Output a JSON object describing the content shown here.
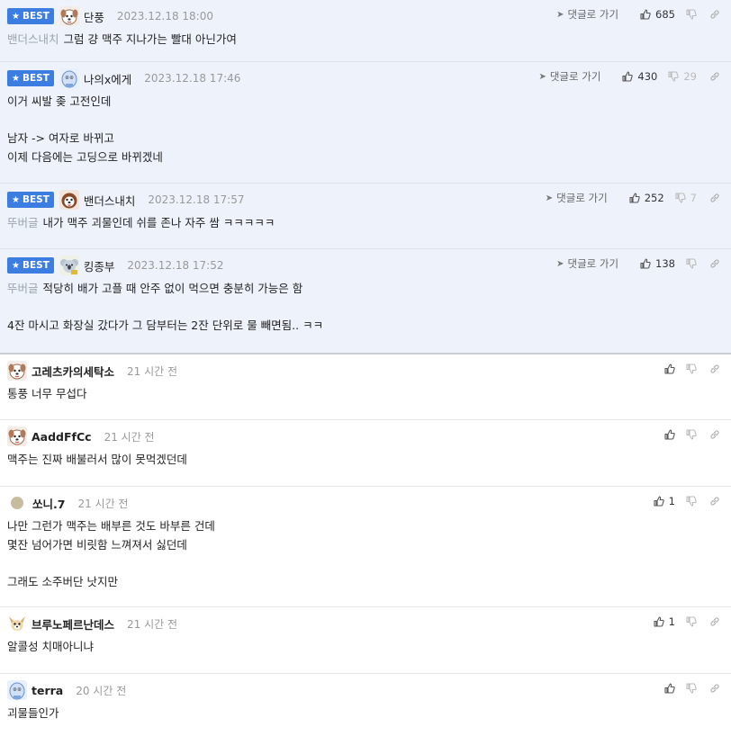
{
  "best_label": "BEST",
  "goto_label": "댓글로 가기",
  "comments": [
    {
      "best": true,
      "nick": "단풍",
      "time": "2023.12.18 18:00",
      "mention": "밴더스내치",
      "lines": [
        "그럼 걍 맥주 지나가는 빨대 아닌가여"
      ],
      "up": "685",
      "down": "",
      "avatar": "dog-white-avatar"
    },
    {
      "best": true,
      "nick": "나의x에게",
      "time": "2023.12.18 17:46",
      "mention": "",
      "lines": [
        "이거 씨발 좆 고전인데",
        "",
        "남자 -> 여자로 바뀌고",
        "이제 다음에는 고딩으로 바뀌겠네"
      ],
      "up": "430",
      "down": "29",
      "avatar": "blue-creature-avatar"
    },
    {
      "best": true,
      "nick": "밴더스내치",
      "time": "2023.12.18 17:57",
      "mention": "뚜버글",
      "lines": [
        "내가 맥주 괴물인데 쉬를 존나 자주 쌈 ㅋㅋㅋㅋㅋ"
      ],
      "up": "252",
      "down": "7",
      "avatar": "dog-brown-avatar"
    },
    {
      "best": true,
      "nick": "킹종부",
      "time": "2023.12.18 17:52",
      "mention": "뚜버글",
      "lines": [
        "적당히 배가 고플 때 안주 없이 먹으면 충분히 가능은 함",
        "",
        "4잔 마시고 화장실 갔다가 그 담부터는 2잔 단위로 물 빼면됨.. ㅋㅋ"
      ],
      "up": "138",
      "down": "",
      "avatar": "koala-avatar"
    },
    {
      "best": false,
      "nick": "고레츠카의세탁소",
      "time": "21 시간 전",
      "mention": "",
      "lines": [
        "통풍 너무 무섭다"
      ],
      "up": "",
      "down": "",
      "avatar": "dog-white-avatar"
    },
    {
      "best": false,
      "nick": "AaddFfCc",
      "time": "21 시간 전",
      "mention": "",
      "lines": [
        "맥주는 진짜 배불러서 많이 못먹겠던데"
      ],
      "up": "",
      "down": "",
      "avatar": "dog-white-avatar"
    },
    {
      "best": false,
      "nick": "쏘니.7",
      "time": "21 시간 전",
      "mention": "",
      "lines": [
        "나만 그런가 맥주는 배부른 것도 바부른 건데",
        "몇잔 넘어가면 비릿함 느껴져서 싫던데",
        "",
        "그래도 소주버단 낫지만"
      ],
      "up": "1",
      "down": "",
      "avatar": "dot-avatar"
    },
    {
      "best": false,
      "nick": "브루노페르난데스",
      "time": "21 시간 전",
      "mention": "",
      "lines": [
        "알콜성 치매아니냐"
      ],
      "up": "1",
      "down": "",
      "avatar": "chihuahua-avatar"
    },
    {
      "best": false,
      "nick": "terra",
      "time": "20 시간 전",
      "mention": "",
      "lines": [
        "괴물들인가"
      ],
      "up": "",
      "down": "",
      "avatar": "blue-creature-avatar"
    }
  ],
  "colors": {
    "best_badge": "#3b7de0",
    "best_bg": "#eef3fb",
    "mention": "#9aa3af",
    "time": "#999999"
  }
}
